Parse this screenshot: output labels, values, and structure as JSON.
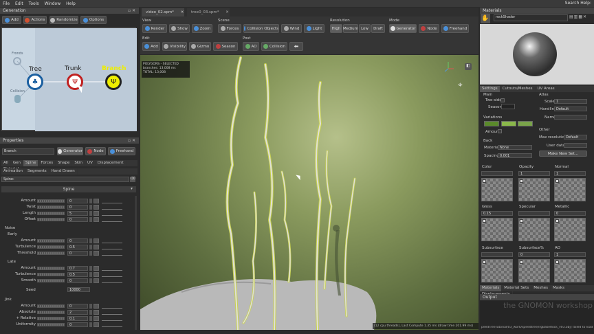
{
  "menu": [
    "File",
    "Edit",
    "Tools",
    "Window",
    "Help"
  ],
  "search_help": "Search Help:",
  "generation": {
    "title": "Generation",
    "buttons": [
      "Add",
      "Actions",
      "Randomize",
      "Options"
    ],
    "nodes": {
      "tree": "Tree",
      "trunk": "Trunk",
      "branch": "Branch",
      "fronds": "Fronds",
      "collision": "Collision"
    }
  },
  "properties": {
    "title": "Properties",
    "name_value": "Branch",
    "mode_buttons": [
      "Generator",
      "Node",
      "Freehand"
    ],
    "tabs": [
      "All",
      "Gen",
      "Spine",
      "Forces",
      "Shape",
      "Skin",
      "UV",
      "Displacement",
      "Material"
    ],
    "subtabs": [
      "Animation",
      "Segments",
      "Hand Drawn"
    ],
    "filter_value": "Spine:",
    "section": "Spine",
    "top_rows": [
      {
        "label": "Amount",
        "value": "0"
      },
      {
        "label": "Twist",
        "value": "0"
      },
      {
        "label": "Length",
        "value": "5"
      },
      {
        "label": "Offset",
        "value": "0"
      }
    ],
    "noise_label": "Noise",
    "early_label": "Early",
    "early_rows": [
      {
        "label": "Amount",
        "value": "0"
      },
      {
        "label": "Turbulence",
        "value": "0.5"
      },
      {
        "label": "Threshold",
        "value": "0"
      }
    ],
    "late_label": "Late",
    "late_rows": [
      {
        "label": "Amount",
        "value": "0.7"
      },
      {
        "label": "Turbulence",
        "value": "0.5"
      },
      {
        "label": "Smooth",
        "value": "0"
      }
    ],
    "seed_label": "Seed",
    "seed_value": "10000",
    "jink_label": "Jink",
    "jink_rows": [
      {
        "label": "Amount",
        "value": "0"
      },
      {
        "label": "Absolute",
        "value": "2"
      },
      {
        "label": "+ Relative",
        "value": "0.1"
      },
      {
        "label": "Uniformity",
        "value": "0"
      }
    ]
  },
  "doc_tabs": [
    "video_02.spm*",
    "tree0_03.spm*"
  ],
  "toolbar": {
    "view_label": "View",
    "view_buttons": [
      "Render",
      "Show",
      "Zoom"
    ],
    "scene_label": "Scene",
    "scene_buttons": [
      "Forces",
      "Collision Objects",
      "Wind",
      "Light"
    ],
    "resolution_label": "Resolution",
    "resolution_buttons": [
      "High",
      "Medium",
      "Low",
      "Draft"
    ],
    "mode_label": "Mode",
    "mode_buttons": [
      "Generator",
      "Node",
      "Freehand"
    ],
    "edit_label": "Edit",
    "edit_buttons": [
      "Add",
      "Visibility",
      "Gizmo",
      "Season"
    ],
    "post_label": "Post",
    "post_buttons": [
      "AO",
      "Collision"
    ]
  },
  "viewport": {
    "stats_title": "POLYGONS - SELECTED",
    "branches_label": "branches:",
    "branches_value": "13,008 ms",
    "total_label": "TOTAL:",
    "total_value": "13,008",
    "status": "(12 cpu threads), Last Compute 1.35 ms (draw time 201.99 ms)"
  },
  "materials": {
    "title": "Materials",
    "material_name": "rockShader",
    "tabs": [
      "Settings",
      "Cutouts/Meshes",
      "UV Areas"
    ],
    "main_label": "Main",
    "two_sided": "Two-sided",
    "season": "Season",
    "variations": "Variations",
    "amount": "Amount",
    "back": "Back",
    "material_label": "Material",
    "material_value": "None",
    "spacing_label": "Spacing",
    "spacing_value": "0.001",
    "atlas_label": "Atlas",
    "scale_label": "Scale",
    "scale_value": "1",
    "handling_label": "Handling",
    "handling_value": "Default",
    "name_label": "Name",
    "other_label": "Other",
    "maxres_label": "Max resolution",
    "maxres_value": "Default",
    "userdata_label": "User data",
    "make_new_set": "Make New Set...",
    "maps": [
      {
        "label": "Color",
        "value": ""
      },
      {
        "label": "Opacity",
        "value": "1"
      },
      {
        "label": "Normal",
        "value": "1"
      },
      {
        "label": "Gloss",
        "value": "0.15"
      },
      {
        "label": "Specular",
        "value": ""
      },
      {
        "label": "Metallic",
        "value": "0"
      },
      {
        "label": "Subsurface",
        "value": ""
      },
      {
        "label": "Subsurface%",
        "value": "0"
      },
      {
        "label": "AO",
        "value": "1"
      }
    ],
    "bottom_tabs": [
      "Materials",
      "Material Sets",
      "Meshes",
      "Masks",
      "Displacements"
    ],
    "swatch_colors": [
      "#5a8a2a",
      "#8ab84a",
      "#7aa44a"
    ]
  },
  "output": {
    "title": "Output",
    "text": "peedTreeTutorial/03_work/speedtree/lrgBaseRock_v03.obj] failed to load.",
    "watermark": "the GNOMON workshop"
  }
}
